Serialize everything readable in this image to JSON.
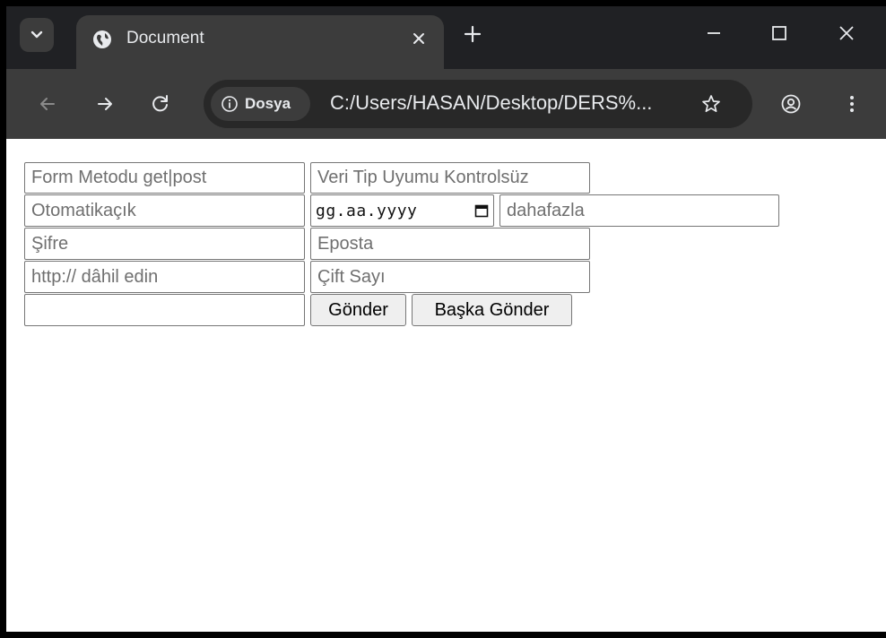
{
  "browser": {
    "tab_title": "Document",
    "url_chip_label": "Dosya",
    "url": "C:/Users/HASAN/Desktop/DERS%...",
    "colors": {
      "frame": "#202124",
      "toolbar": "#3c3c3c",
      "omnibox": "#282828",
      "text": "#e8eaed"
    }
  },
  "form": {
    "method_placeholder": "Form Metodu get|post",
    "no_validation_placeholder": "Veri Tip Uyumu Kontrolsüz",
    "autofocus_placeholder": "Otomatikaçık",
    "date_placeholder": "gg.aa.yyyy",
    "more_placeholder": "dahafazla",
    "password_placeholder": "Şifre",
    "email_placeholder": "Eposta",
    "url_placeholder": "http:// dâhil edin",
    "even_number_placeholder": "Çift Sayı",
    "empty_value": "",
    "submit_label": "Gönder",
    "submit_other_label": "Başka Gönder"
  }
}
